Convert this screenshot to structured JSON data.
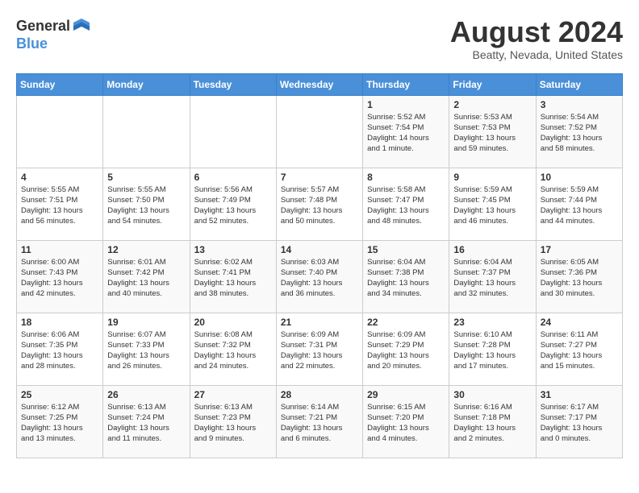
{
  "header": {
    "logo_general": "General",
    "logo_blue": "Blue",
    "month_year": "August 2024",
    "location": "Beatty, Nevada, United States"
  },
  "days_of_week": [
    "Sunday",
    "Monday",
    "Tuesday",
    "Wednesday",
    "Thursday",
    "Friday",
    "Saturday"
  ],
  "weeks": [
    [
      {
        "day": "",
        "info": ""
      },
      {
        "day": "",
        "info": ""
      },
      {
        "day": "",
        "info": ""
      },
      {
        "day": "",
        "info": ""
      },
      {
        "day": "1",
        "info": "Sunrise: 5:52 AM\nSunset: 7:54 PM\nDaylight: 14 hours\nand 1 minute."
      },
      {
        "day": "2",
        "info": "Sunrise: 5:53 AM\nSunset: 7:53 PM\nDaylight: 13 hours\nand 59 minutes."
      },
      {
        "day": "3",
        "info": "Sunrise: 5:54 AM\nSunset: 7:52 PM\nDaylight: 13 hours\nand 58 minutes."
      }
    ],
    [
      {
        "day": "4",
        "info": "Sunrise: 5:55 AM\nSunset: 7:51 PM\nDaylight: 13 hours\nand 56 minutes."
      },
      {
        "day": "5",
        "info": "Sunrise: 5:55 AM\nSunset: 7:50 PM\nDaylight: 13 hours\nand 54 minutes."
      },
      {
        "day": "6",
        "info": "Sunrise: 5:56 AM\nSunset: 7:49 PM\nDaylight: 13 hours\nand 52 minutes."
      },
      {
        "day": "7",
        "info": "Sunrise: 5:57 AM\nSunset: 7:48 PM\nDaylight: 13 hours\nand 50 minutes."
      },
      {
        "day": "8",
        "info": "Sunrise: 5:58 AM\nSunset: 7:47 PM\nDaylight: 13 hours\nand 48 minutes."
      },
      {
        "day": "9",
        "info": "Sunrise: 5:59 AM\nSunset: 7:45 PM\nDaylight: 13 hours\nand 46 minutes."
      },
      {
        "day": "10",
        "info": "Sunrise: 5:59 AM\nSunset: 7:44 PM\nDaylight: 13 hours\nand 44 minutes."
      }
    ],
    [
      {
        "day": "11",
        "info": "Sunrise: 6:00 AM\nSunset: 7:43 PM\nDaylight: 13 hours\nand 42 minutes."
      },
      {
        "day": "12",
        "info": "Sunrise: 6:01 AM\nSunset: 7:42 PM\nDaylight: 13 hours\nand 40 minutes."
      },
      {
        "day": "13",
        "info": "Sunrise: 6:02 AM\nSunset: 7:41 PM\nDaylight: 13 hours\nand 38 minutes."
      },
      {
        "day": "14",
        "info": "Sunrise: 6:03 AM\nSunset: 7:40 PM\nDaylight: 13 hours\nand 36 minutes."
      },
      {
        "day": "15",
        "info": "Sunrise: 6:04 AM\nSunset: 7:38 PM\nDaylight: 13 hours\nand 34 minutes."
      },
      {
        "day": "16",
        "info": "Sunrise: 6:04 AM\nSunset: 7:37 PM\nDaylight: 13 hours\nand 32 minutes."
      },
      {
        "day": "17",
        "info": "Sunrise: 6:05 AM\nSunset: 7:36 PM\nDaylight: 13 hours\nand 30 minutes."
      }
    ],
    [
      {
        "day": "18",
        "info": "Sunrise: 6:06 AM\nSunset: 7:35 PM\nDaylight: 13 hours\nand 28 minutes."
      },
      {
        "day": "19",
        "info": "Sunrise: 6:07 AM\nSunset: 7:33 PM\nDaylight: 13 hours\nand 26 minutes."
      },
      {
        "day": "20",
        "info": "Sunrise: 6:08 AM\nSunset: 7:32 PM\nDaylight: 13 hours\nand 24 minutes."
      },
      {
        "day": "21",
        "info": "Sunrise: 6:09 AM\nSunset: 7:31 PM\nDaylight: 13 hours\nand 22 minutes."
      },
      {
        "day": "22",
        "info": "Sunrise: 6:09 AM\nSunset: 7:29 PM\nDaylight: 13 hours\nand 20 minutes."
      },
      {
        "day": "23",
        "info": "Sunrise: 6:10 AM\nSunset: 7:28 PM\nDaylight: 13 hours\nand 17 minutes."
      },
      {
        "day": "24",
        "info": "Sunrise: 6:11 AM\nSunset: 7:27 PM\nDaylight: 13 hours\nand 15 minutes."
      }
    ],
    [
      {
        "day": "25",
        "info": "Sunrise: 6:12 AM\nSunset: 7:25 PM\nDaylight: 13 hours\nand 13 minutes."
      },
      {
        "day": "26",
        "info": "Sunrise: 6:13 AM\nSunset: 7:24 PM\nDaylight: 13 hours\nand 11 minutes."
      },
      {
        "day": "27",
        "info": "Sunrise: 6:13 AM\nSunset: 7:23 PM\nDaylight: 13 hours\nand 9 minutes."
      },
      {
        "day": "28",
        "info": "Sunrise: 6:14 AM\nSunset: 7:21 PM\nDaylight: 13 hours\nand 6 minutes."
      },
      {
        "day": "29",
        "info": "Sunrise: 6:15 AM\nSunset: 7:20 PM\nDaylight: 13 hours\nand 4 minutes."
      },
      {
        "day": "30",
        "info": "Sunrise: 6:16 AM\nSunset: 7:18 PM\nDaylight: 13 hours\nand 2 minutes."
      },
      {
        "day": "31",
        "info": "Sunrise: 6:17 AM\nSunset: 7:17 PM\nDaylight: 13 hours\nand 0 minutes."
      }
    ]
  ]
}
